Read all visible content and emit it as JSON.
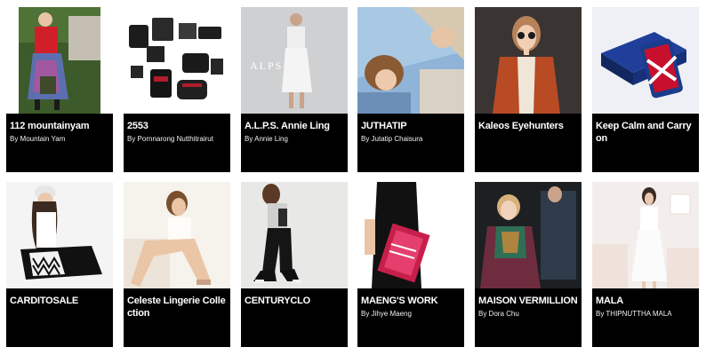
{
  "brands": [
    {
      "name": "112 mountainyam",
      "by": "By Mountain Yam",
      "thumb_icon": "fashion-photo"
    },
    {
      "name": "2553",
      "by": "By Pornnarong Nutthitrairut",
      "thumb_icon": "bags-product-photo"
    },
    {
      "name": "A.L.P.S. Annie Ling",
      "by": "By Annie Ling",
      "thumb_icon": "fashion-photo"
    },
    {
      "name": "JUTHATIP",
      "by": "By Jutatip Chaisura",
      "thumb_icon": "portrait-photo"
    },
    {
      "name": "Kaleos Eyehunters",
      "by": "",
      "thumb_icon": "sunglasses-portrait-photo"
    },
    {
      "name": "Keep Calm and Carry on",
      "by": "",
      "thumb_icon": "phone-case-product-photo"
    },
    {
      "name": "CARDITOSALE",
      "by": "",
      "thumb_icon": "handbag-fashion-photo"
    },
    {
      "name": "Celeste Lingerie Collection",
      "by": "",
      "thumb_icon": "lingerie-photo"
    },
    {
      "name": "CENTURYCLO",
      "by": "",
      "thumb_icon": "fashion-photo"
    },
    {
      "name": "MAENG'S WORK",
      "by": "By Jihye Maeng",
      "thumb_icon": "magazine-fashion-photo"
    },
    {
      "name": "MAISON VERMILLION",
      "by": "By Dora Chu",
      "thumb_icon": "runway-photo"
    },
    {
      "name": "MALA",
      "by": "By THIPNUTTHA MALA",
      "thumb_icon": "dress-fashion-photo"
    }
  ],
  "colors": {
    "caption_bg": "#000000",
    "caption_text": "#ffffff",
    "page_bg": "#ffffff"
  }
}
